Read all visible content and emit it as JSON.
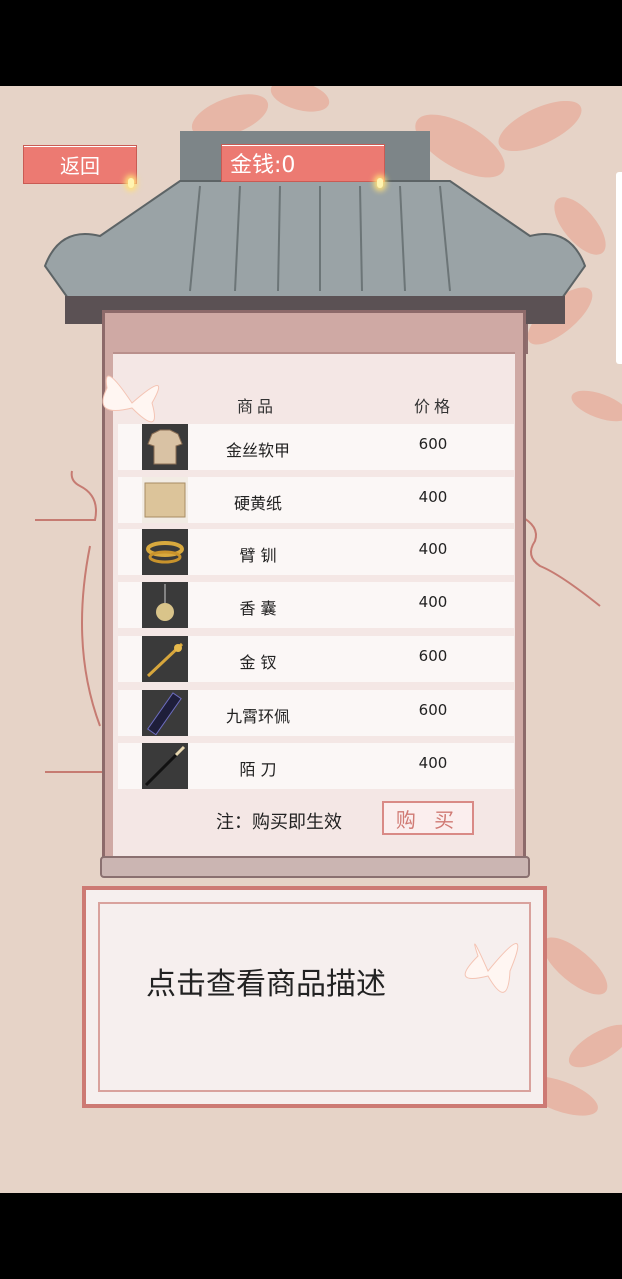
{
  "header": {
    "back_label": "返回",
    "money_label": "金钱:0"
  },
  "table": {
    "col_item": "商品",
    "col_price": "价格",
    "rows": [
      {
        "name": "金丝软甲",
        "price": "600",
        "icon": "armor-icon"
      },
      {
        "name": "硬黄纸",
        "price": "400",
        "icon": "paper-scroll-icon"
      },
      {
        "name": "臂 钏",
        "price": "400",
        "icon": "armlet-icon"
      },
      {
        "name": "香 囊",
        "price": "400",
        "icon": "sachet-icon"
      },
      {
        "name": "金 钗",
        "price": "600",
        "icon": "hairpin-icon"
      },
      {
        "name": "九霄环佩",
        "price": "600",
        "icon": "guqin-icon"
      },
      {
        "name": "陌 刀",
        "price": "400",
        "icon": "blade-icon"
      }
    ]
  },
  "footer": {
    "note": "注：购买即生效",
    "buy_label": "购 买"
  },
  "description": {
    "placeholder": "点击查看商品描述"
  },
  "colors": {
    "accent_red": "#ec7a72",
    "background": "#e6d3c7",
    "paper": "#f4e7e5"
  }
}
